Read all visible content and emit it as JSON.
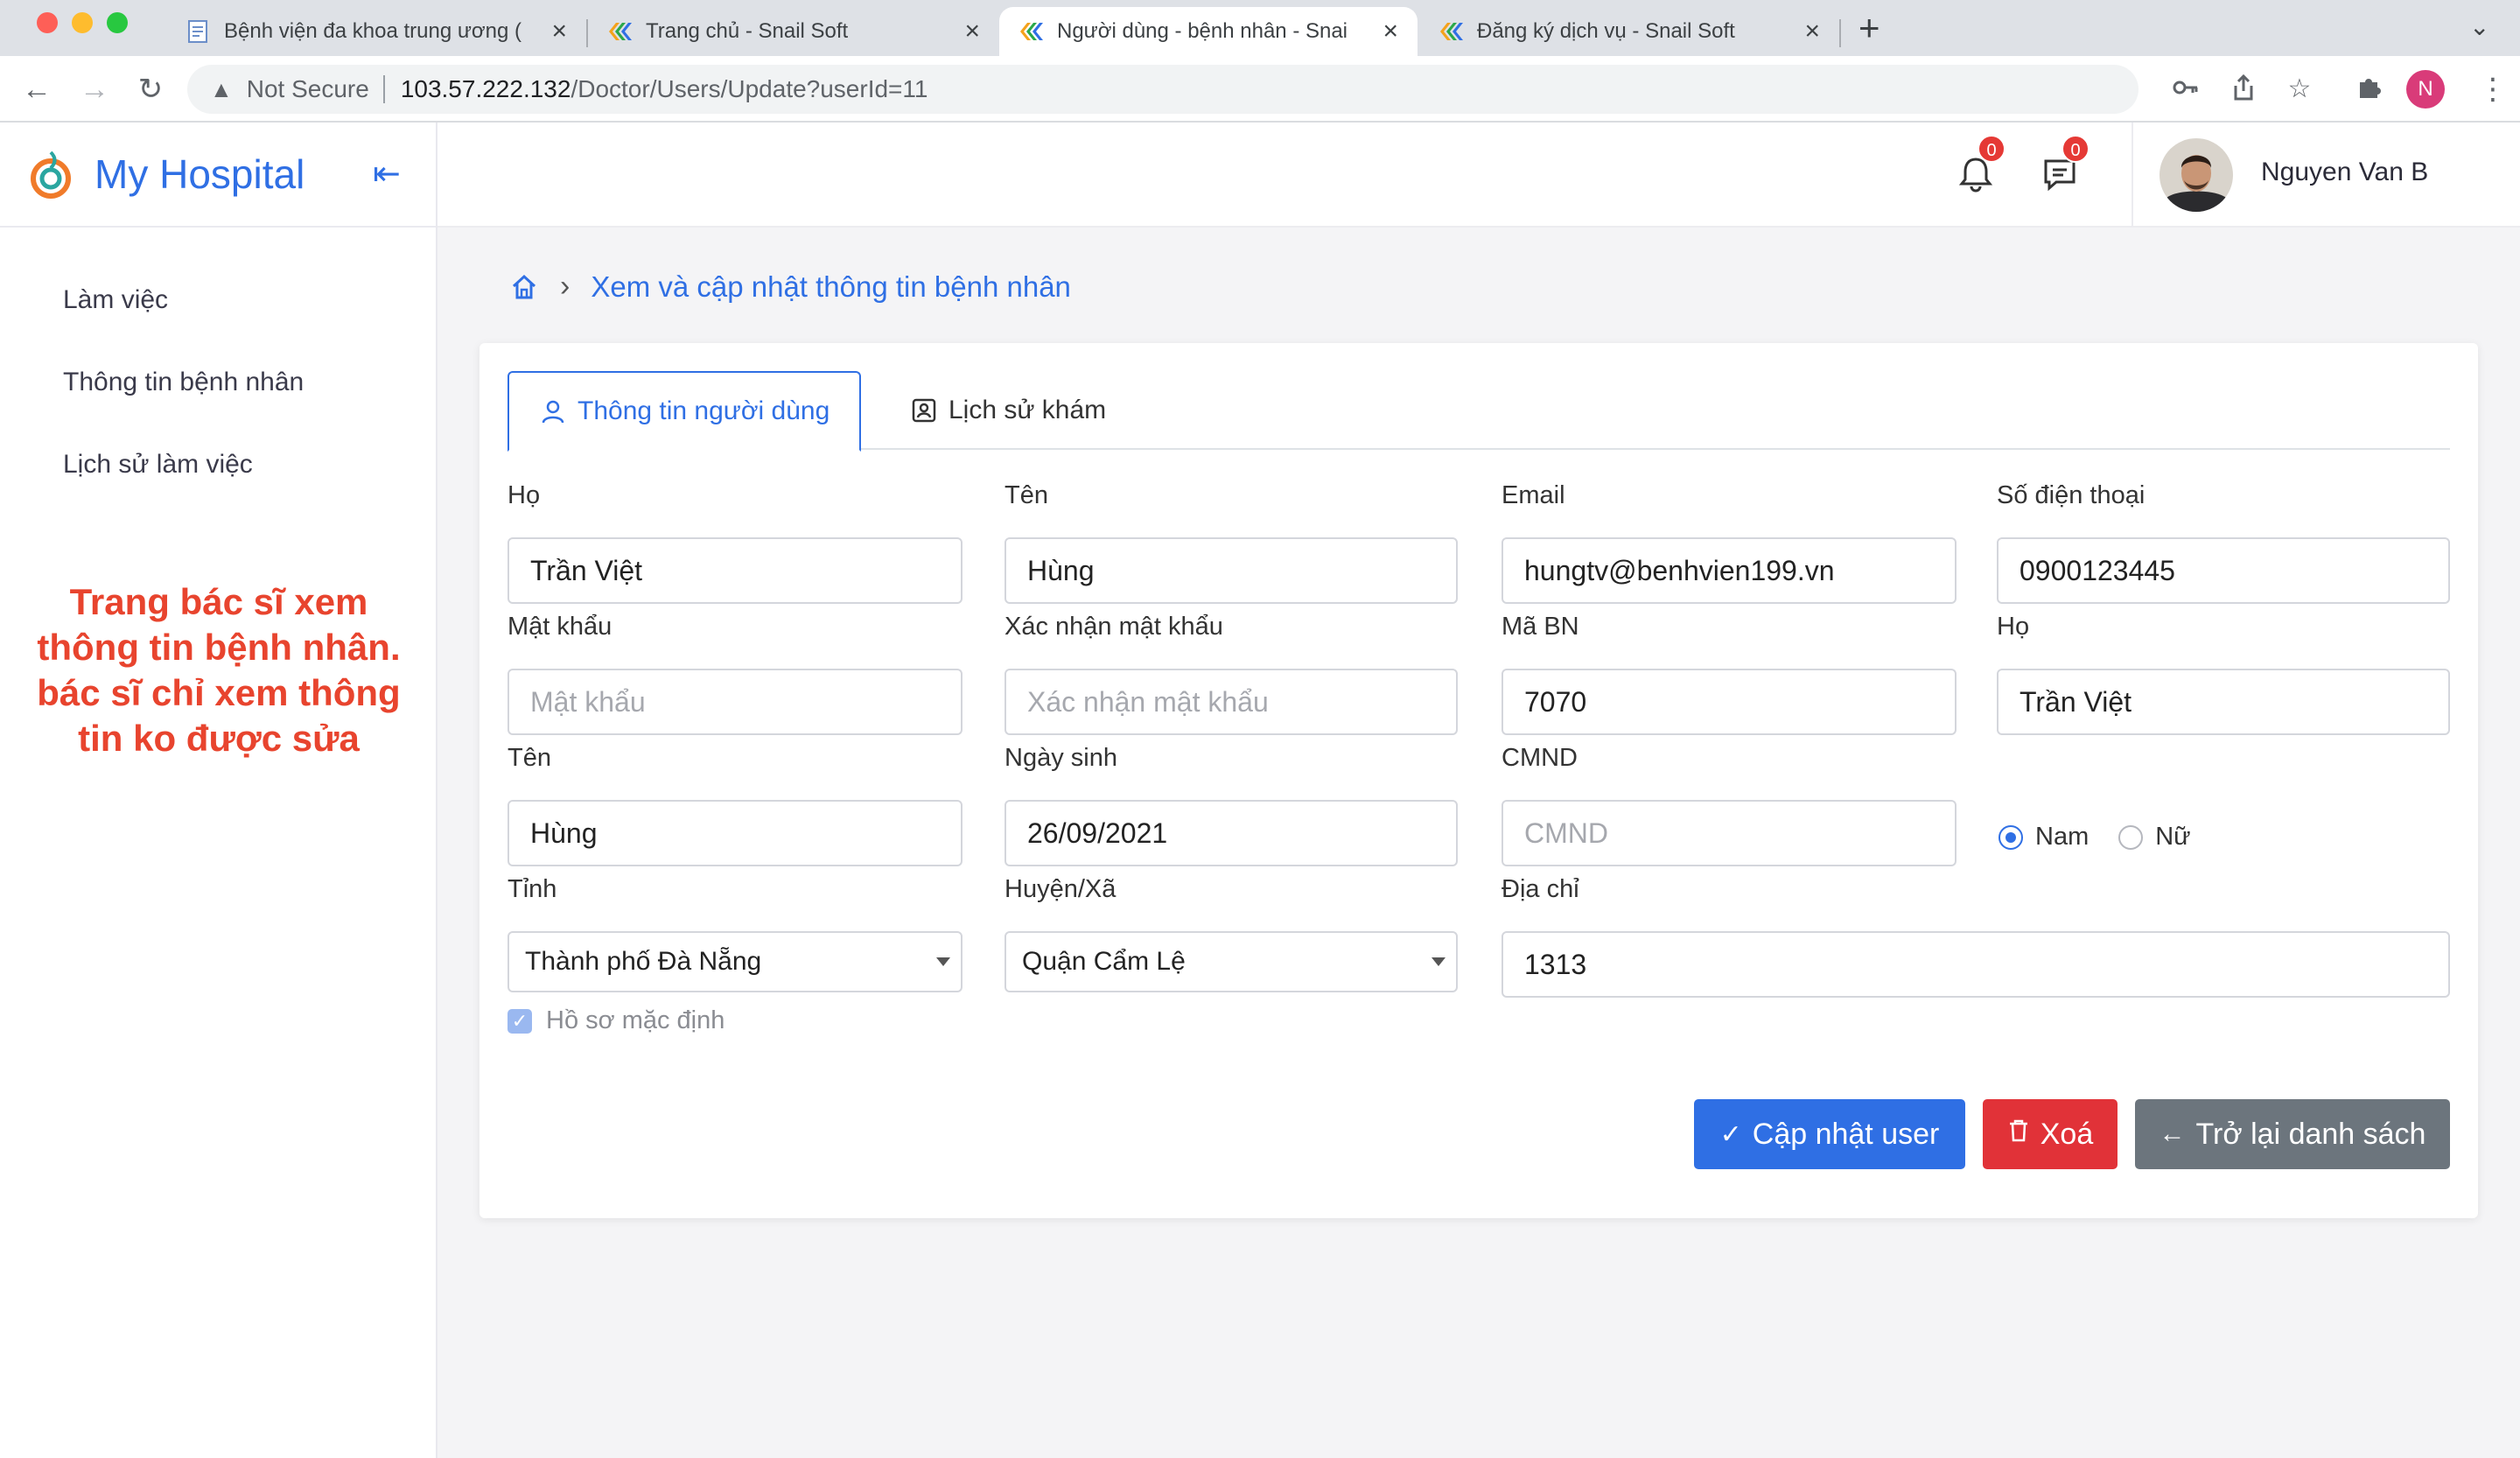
{
  "browser": {
    "tabs": [
      {
        "title": "Bệnh viện đa khoa trung ương (",
        "active": false
      },
      {
        "title": "Trang chủ - Snail Soft",
        "active": false
      },
      {
        "title": "Người dùng - bệnh nhân - Snai",
        "active": true
      },
      {
        "title": "Đăng ký dịch vụ - Snail Soft",
        "active": false
      }
    ],
    "security_label": "Not Secure",
    "url_host": "103.57.222.132",
    "url_path": "/Doctor/Users/Update?userId=11",
    "profile_initial": "N"
  },
  "sidebar": {
    "brand": "My Hospital",
    "items": [
      {
        "label": "Làm việc"
      },
      {
        "label": "Thông tin bệnh nhân"
      },
      {
        "label": "Lịch sử làm việc"
      }
    ],
    "note": "Trang bác sĩ xem thông tin bệnh nhân. bác sĩ chỉ xem thông tin ko được sửa"
  },
  "topbar": {
    "notifications_count": "0",
    "messages_count": "0",
    "username": "Nguyen Van B"
  },
  "breadcrumb": {
    "current": "Xem và cập nhật thông tin bệnh nhân"
  },
  "tabs": {
    "user_info": "Thông tin người dùng",
    "history": "Lịch sử khám"
  },
  "form": {
    "ho": {
      "label": "Họ",
      "value": "Trần Việt"
    },
    "ten": {
      "label": "Tên",
      "value": "Hùng"
    },
    "email": {
      "label": "Email",
      "value": "hungtv@benhvien199.vn"
    },
    "phone": {
      "label": "Số điện thoại",
      "value": "0900123445"
    },
    "password": {
      "label": "Mật khẩu",
      "placeholder": "Mật khẩu"
    },
    "confirm_password": {
      "label": "Xác nhận mật khẩu",
      "placeholder": "Xác nhận mật khẩu"
    },
    "ma_bn": {
      "label": "Mã BN",
      "value": "7070"
    },
    "ho2": {
      "label": "Họ",
      "value": "Trần Việt"
    },
    "ten2": {
      "label": "Tên",
      "value": "Hùng"
    },
    "dob": {
      "label": "Ngày sinh",
      "value": "26/09/2021"
    },
    "cmnd": {
      "label": "CMND",
      "placeholder": "CMND"
    },
    "gender": {
      "male": "Nam",
      "female": "Nữ",
      "selected": "Nam"
    },
    "province": {
      "label": "Tỉnh",
      "value": "Thành phố Đà Nẵng"
    },
    "district": {
      "label": "Huyện/Xã",
      "value": "Quận Cẩm Lệ"
    },
    "address": {
      "label": "Địa chỉ",
      "value": "1313"
    },
    "default_profile": {
      "label": "Hồ sơ mặc định",
      "checked": true
    }
  },
  "actions": {
    "update": "Cập nhật user",
    "delete": "Xoá",
    "back": "Trở lại danh sách"
  },
  "colors": {
    "accent": "#2f6fe4",
    "danger": "#e13238",
    "secondary": "#6c757d",
    "note": "#e8442e"
  }
}
